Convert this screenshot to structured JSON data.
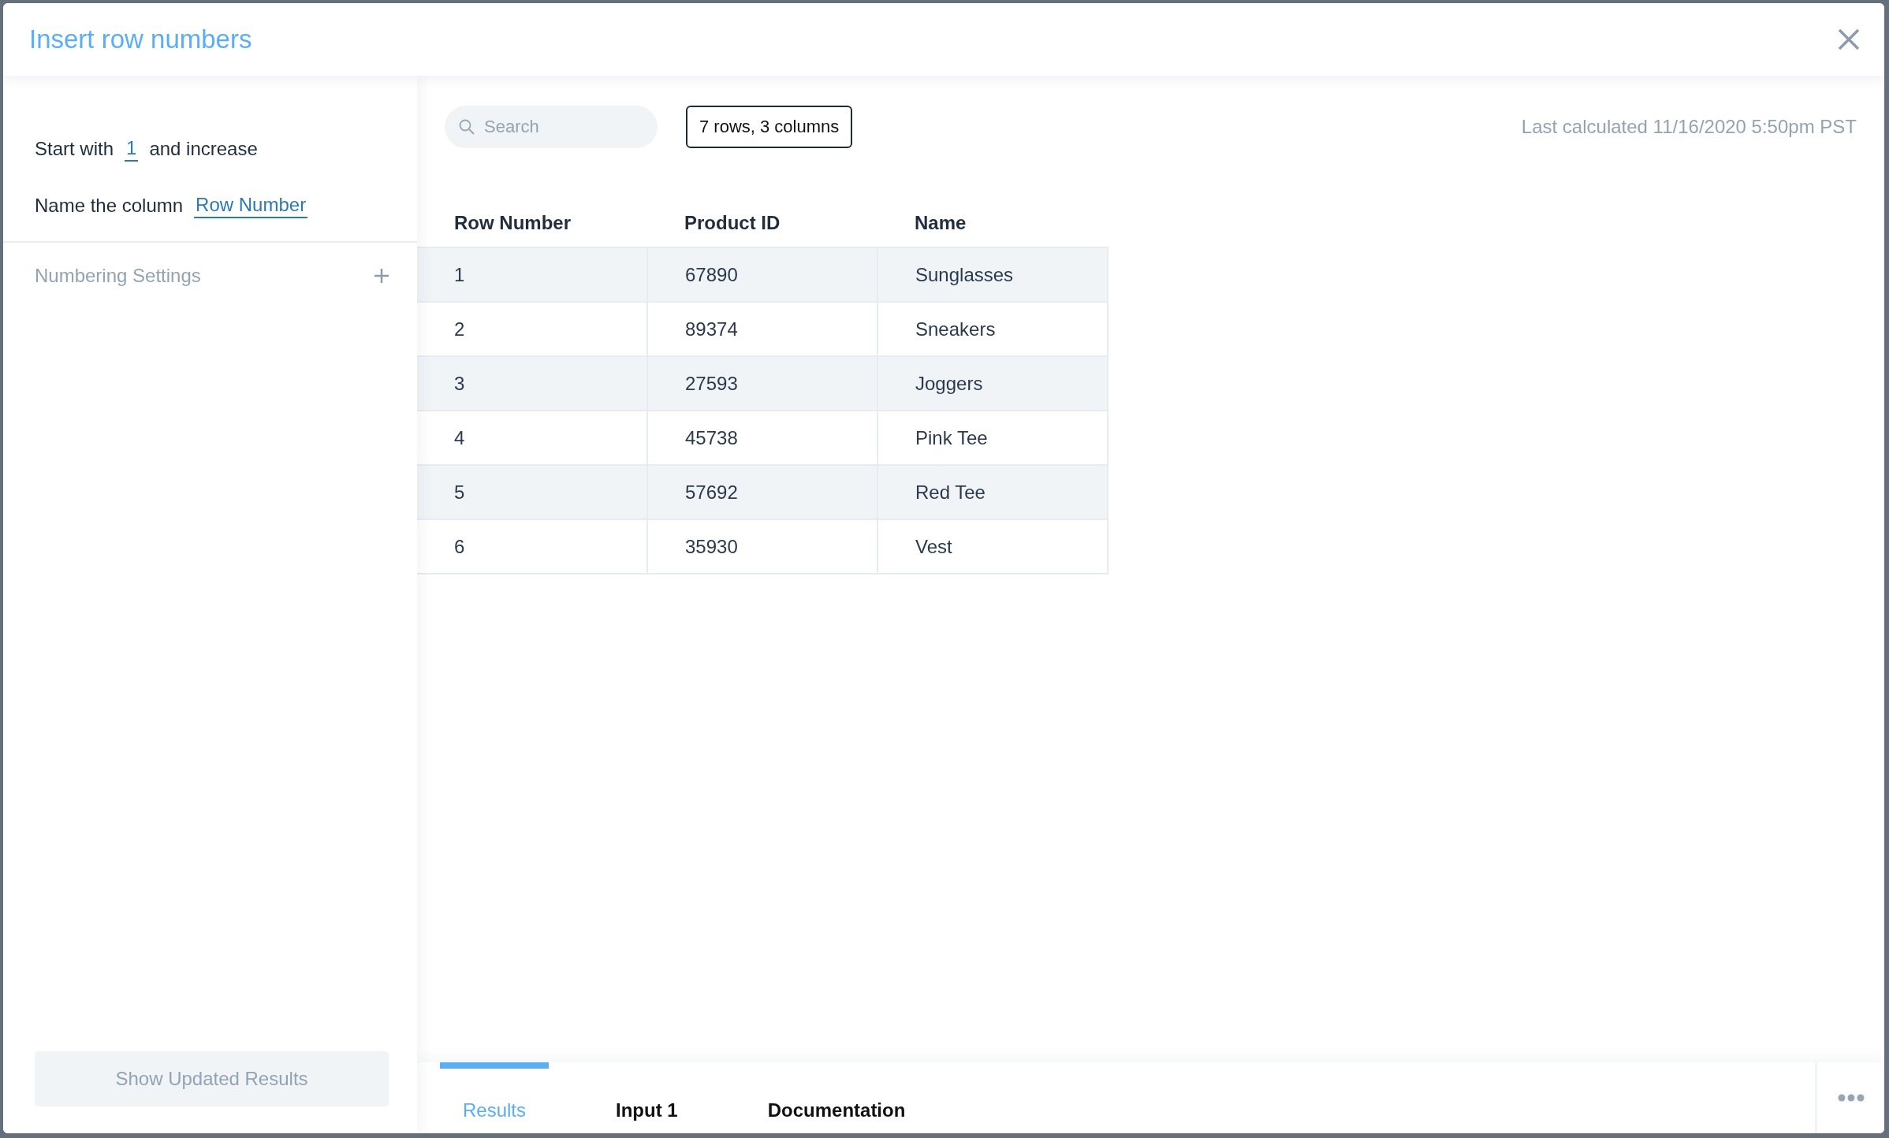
{
  "dialog": {
    "title": "Insert row numbers"
  },
  "settings": {
    "start_label": "Start with",
    "start_value": "1",
    "start_suffix": "and increase",
    "name_label": "Name the column",
    "name_value": "Row Number",
    "section": {
      "label": "Numbering Settings",
      "expanded": false
    },
    "apply_button": {
      "label": "Show Updated Results",
      "disabled": true
    }
  },
  "results": {
    "search": {
      "placeholder": "Search"
    },
    "summary": "7 rows, 3 columns",
    "last_calculated": "Last calculated 11/16/2020 5:50pm PST",
    "table": {
      "columns": [
        "Row Number",
        "Product ID",
        "Name"
      ],
      "rows": [
        [
          "1",
          "67890",
          "Sunglasses"
        ],
        [
          "2",
          "89374",
          "Sneakers"
        ],
        [
          "3",
          "27593",
          "Joggers"
        ],
        [
          "4",
          "45738",
          "Pink Tee"
        ],
        [
          "5",
          "57692",
          "Red Tee"
        ],
        [
          "6",
          "35930",
          "Vest"
        ]
      ]
    }
  },
  "tabs": [
    {
      "label": "Results",
      "selected": true
    },
    {
      "label": "Input 1",
      "selected": false
    },
    {
      "label": "Documentation",
      "selected": false
    }
  ]
}
